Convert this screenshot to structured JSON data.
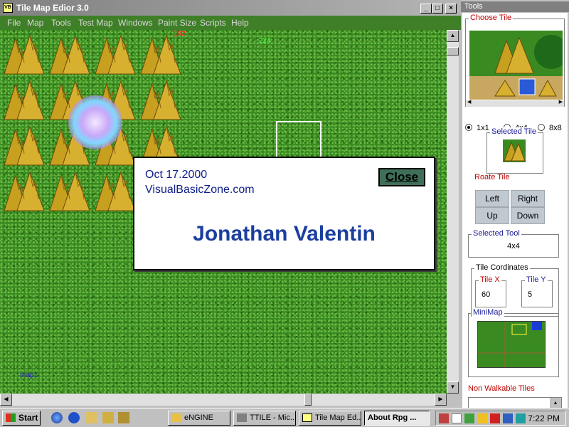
{
  "window": {
    "title": "Tile Map Edior 3.0"
  },
  "menu": {
    "items": [
      {
        "label": "File"
      },
      {
        "label": "Map"
      },
      {
        "label": "Tools"
      },
      {
        "label": "Test Map"
      },
      {
        "label": "Windows"
      },
      {
        "label": "Paint Size"
      },
      {
        "label": "Scripts"
      },
      {
        "label": "Help"
      }
    ]
  },
  "map": {
    "coord_red": "192",
    "coord_green": "224",
    "label": "map1"
  },
  "about": {
    "date": "Oct 17.2000",
    "site": "VisualBasicZone.com",
    "author": "Jonathan Valentin",
    "close_label": "Close"
  },
  "tools": {
    "title": "Tools",
    "choose_tile_label": "Choose Tile",
    "size_options": [
      {
        "label": "1x1",
        "selected": true
      },
      {
        "label": "4x4",
        "selected": false
      },
      {
        "label": "8x8",
        "selected": false
      }
    ],
    "selected_tile_label": "Selected Tile",
    "rotate_label": "Roate Tile",
    "rotate_buttons": {
      "left": "Left",
      "right": "Right",
      "up": "Up",
      "down": "Down"
    },
    "selected_tool_label": "Selected Tool",
    "selected_tool_value": "4x4",
    "tile_coordinates_label": "Tile Cordinates",
    "tile_x_label": "Tile X",
    "tile_x_value": "60",
    "tile_y_label": "Tile Y",
    "tile_y_value": "5",
    "minimap_label": "MiniMap",
    "non_walkable_label": "Non Walkable Tiles"
  },
  "taskbar": {
    "start_label": "Start",
    "tasks": [
      {
        "label": "eNGINE"
      },
      {
        "label": "TTILE - Mic..."
      },
      {
        "label": "Tile Map Ed..."
      },
      {
        "label": "About Rpg ..."
      }
    ],
    "clock": "7:22 PM"
  },
  "colors": {
    "grass": "#3a8a22",
    "menu_bg": "#3f7f28",
    "about_text": "#10208a",
    "label_red": "#c00000"
  }
}
